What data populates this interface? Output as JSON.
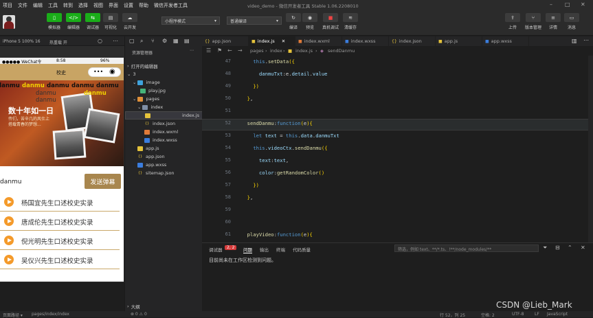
{
  "menubar": {
    "items": [
      "项目",
      "文件",
      "编辑",
      "工具",
      "转到",
      "选择",
      "视图",
      "界面",
      "设置",
      "帮助",
      "微信开发者工具"
    ],
    "title": "video_demo - 微信开发者工具 Stable 1.06.2208010"
  },
  "toolbar": {
    "simulator": "模拟器",
    "editor": "编辑器",
    "debugger": "调试器",
    "visual": "可视化",
    "cloud": "云开发",
    "mode_select": "小程序模式",
    "compile_select": "普通编译",
    "compile": "编译",
    "preview": "预览",
    "remote_debug": "真机调试",
    "clear_cache": "清缓存",
    "upload": "上传",
    "version": "版本管理",
    "detail": "详情",
    "message": "消息"
  },
  "simulator": {
    "device": "iPhone 5 100% 16",
    "hotreload": "热重载 开",
    "status_carrier": "●●●●● WeChat令",
    "status_time": "8:58",
    "status_battery": "96%",
    "nav_title": "校史",
    "danmu_line": [
      "danmu",
      "danmu",
      "danmu",
      "danmu",
      "danmu"
    ],
    "danmu_mid": [
      "danmu",
      "danmu",
      "danmu"
    ],
    "video_title": "数十年如一日",
    "video_sub": [
      "传们，苦辛几的风仕上",
      "搭载青春的梦想..."
    ],
    "input_label": "danmu",
    "send_button": "发送弹幕",
    "videos": [
      "杨国宜先生口述校史实录",
      "唐成伦先生口述校史实录",
      "倪光明先生口述校史实录",
      "吴仪兴先生口述校史实录"
    ]
  },
  "explorer": {
    "header": "资源管理器",
    "open_editors": "打开的编辑器",
    "root": "3",
    "tree": [
      {
        "label": "image",
        "icon": "folder"
      },
      {
        "label": "play.jpg",
        "icon": "img"
      },
      {
        "label": "pages",
        "icon": "folder"
      },
      {
        "label": "index",
        "icon": "folder"
      },
      {
        "label": "index.js",
        "icon": "js"
      },
      {
        "label": "index.json",
        "icon": "json"
      },
      {
        "label": "index.wxml",
        "icon": "wxml"
      },
      {
        "label": "index.wxss",
        "icon": "wxss"
      },
      {
        "label": "app.js",
        "icon": "js"
      },
      {
        "label": "app.json",
        "icon": "json"
      },
      {
        "label": "app.wxss",
        "icon": "wxss"
      },
      {
        "label": "sitemap.json",
        "icon": "json"
      }
    ],
    "outline": "大纲"
  },
  "tabs": [
    "app.json",
    "index.js",
    "index.wxml",
    "index.wxss",
    "index.json",
    "app.js",
    "app.wxss"
  ],
  "breadcrumb": [
    "pages",
    "index",
    "index.js",
    "sendDanmu"
  ],
  "code": {
    "lines": [
      {
        "n": "47",
        "t": "    this.setData({"
      },
      {
        "n": "48",
        "t": "      danmuTxt:e.detail.value"
      },
      {
        "n": "49",
        "t": "    })"
      },
      {
        "n": "50",
        "t": "  },"
      },
      {
        "n": "51",
        "t": ""
      },
      {
        "n": "52",
        "t": "  sendDanmu:function(e){"
      },
      {
        "n": "53",
        "t": "    let text = this.data.danmuTxt"
      },
      {
        "n": "54",
        "t": "    this.videoCtx.sendDanmu({"
      },
      {
        "n": "55",
        "t": "      text:text,"
      },
      {
        "n": "56",
        "t": "      color:getRandomColor()"
      },
      {
        "n": "57",
        "t": "    })"
      },
      {
        "n": "58",
        "t": "  },"
      },
      {
        "n": "59",
        "t": ""
      },
      {
        "n": "60",
        "t": ""
      },
      {
        "n": "61",
        "t": "  playVideo:function(e){"
      },
      {
        "n": "62",
        "t": "    this.videoCtx.stop()"
      }
    ]
  },
  "panel": {
    "tabs": [
      "调试器",
      "2, 2",
      "问题",
      "输出",
      "终端",
      "代码质量"
    ],
    "filter_placeholder": "筛选，例如 text、**/*.ts、!**/node_modules/**",
    "message": "目前尚未在工作区检测到问题。"
  },
  "statusbar": {
    "path": "页面路径 ▾",
    "page": "pages/index/index",
    "errors": "⊗ 0 ⚠ 0",
    "position": "行 52，列 25",
    "spaces": "空格: 2",
    "encoding": "UTF-8",
    "eol": "LF",
    "lang": "JavaScript"
  },
  "watermark": "CSDN @Lieb_Mark"
}
